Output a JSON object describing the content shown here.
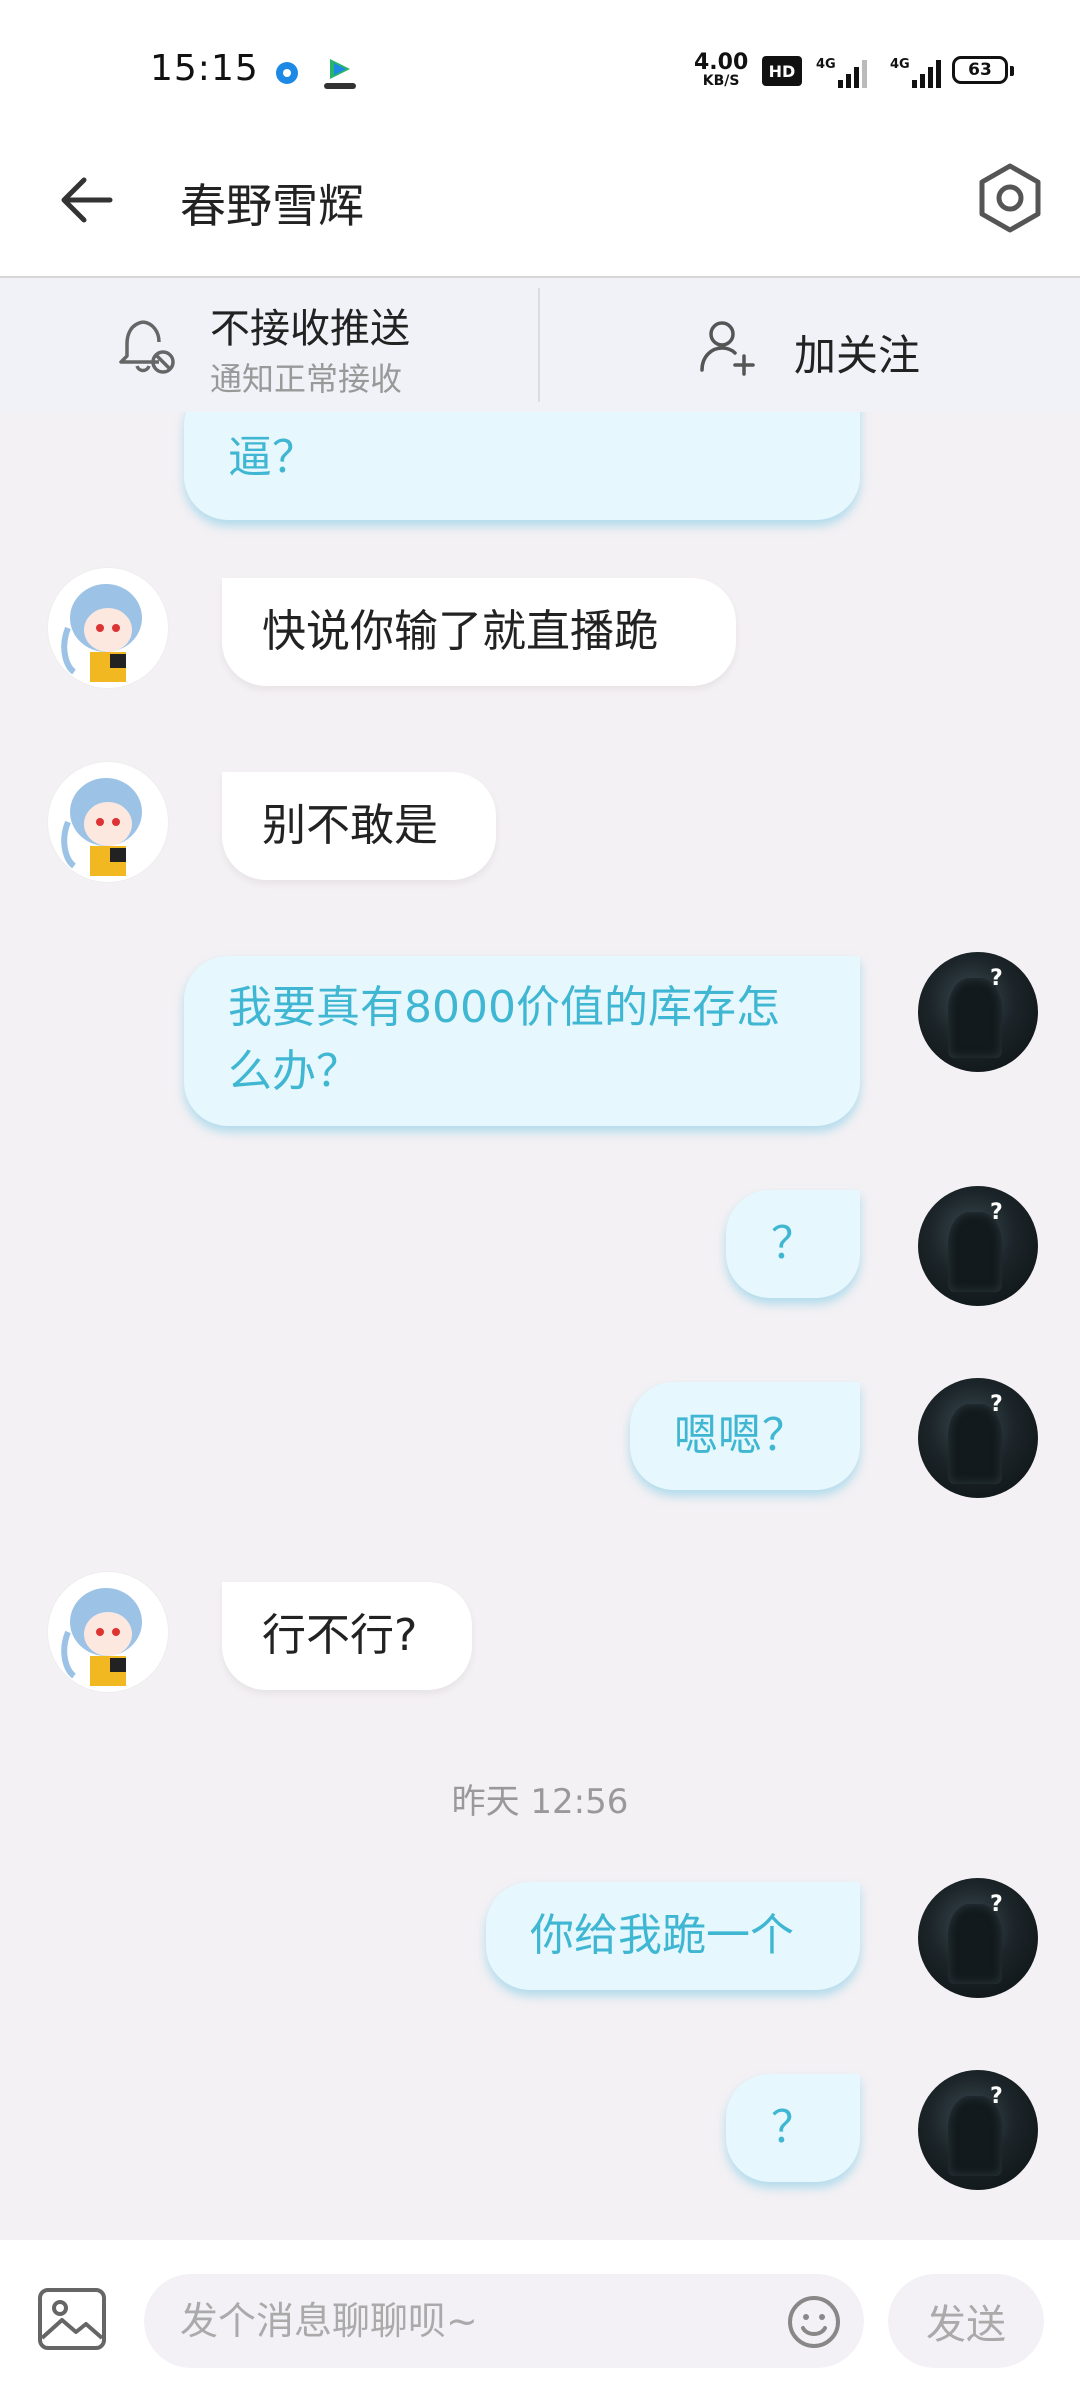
{
  "status": {
    "time": "15:15",
    "net_speed": "4.00",
    "net_unit": "KB/S",
    "hd": "HD",
    "sig1": "4G",
    "sig2": "4G",
    "battery": "63"
  },
  "header": {
    "title": "春野雪辉"
  },
  "follow_bar": {
    "push_title": "不接收推送",
    "push_sub": "通知正常接收",
    "follow_label": "加关注"
  },
  "messages": [
    {
      "from": "me",
      "text": "逼？"
    },
    {
      "from": "other",
      "text": "快说你输了就直播跪"
    },
    {
      "from": "other",
      "text": "别不敢是"
    },
    {
      "from": "me",
      "text": "我要真有8000价值的库存怎么办？"
    },
    {
      "from": "me",
      "text": "？"
    },
    {
      "from": "me",
      "text": "嗯嗯？"
    },
    {
      "from": "other",
      "text": "行不行?"
    },
    {
      "from": "me",
      "text": "你给我跪一个"
    },
    {
      "from": "me",
      "text": "？"
    }
  ],
  "timestamp": "昨天 12:56",
  "input": {
    "placeholder": "发个消息聊聊呗~",
    "send_label": "发送"
  },
  "avatar_mark": "?"
}
